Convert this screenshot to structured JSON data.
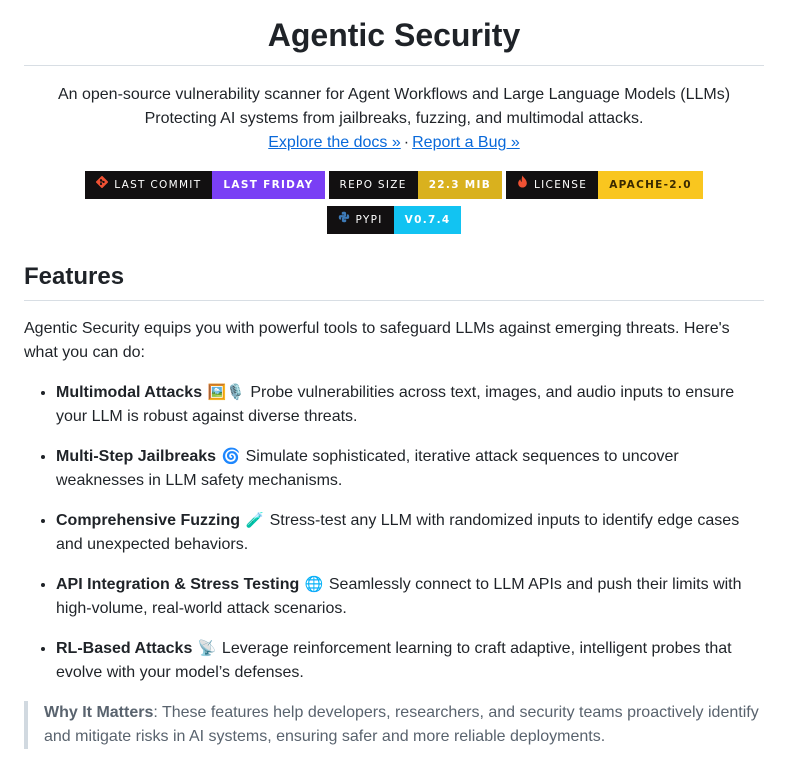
{
  "title": "Agentic Security",
  "description": {
    "line1": "An open-source vulnerability scanner for Agent Workflows and Large Language Models (LLMs)",
    "line2": "Protecting AI systems from jailbreaks, fuzzing, and multimodal attacks.",
    "docs_link": "Explore the docs »",
    "separator": "·",
    "bug_link": "Report a Bug »"
  },
  "badges": [
    {
      "label": "LAST COMMIT",
      "value": "LAST FRIDAY",
      "icon": "git-icon",
      "value_color": "#7a3ff5"
    },
    {
      "label": "REPO SIZE",
      "value": "22.3 MIB",
      "icon": "",
      "value_color": "#d9b11e"
    },
    {
      "label": "LICENSE",
      "value": "APACHE-2.0",
      "icon": "fire-icon",
      "value_color": "#f9c61f"
    },
    {
      "label": "PYPI",
      "value": "V0.7.4",
      "icon": "python-icon",
      "value_color": "#12c3f2"
    }
  ],
  "features": {
    "heading": "Features",
    "intro": "Agentic Security equips you with powerful tools to safeguard LLMs against emerging threats. Here's what you can do:",
    "items": [
      {
        "title": "Multimodal Attacks",
        "emoji": "🖼️🎙️",
        "text": " Probe vulnerabilities across text, images, and audio inputs to ensure your LLM is robust against diverse threats."
      },
      {
        "title": "Multi-Step Jailbreaks",
        "emoji": "🌀",
        "text": " Simulate sophisticated, iterative attack sequences to uncover weaknesses in LLM safety mechanisms."
      },
      {
        "title": "Comprehensive Fuzzing",
        "emoji": "🧪",
        "text": " Stress-test any LLM with randomized inputs to identify edge cases and unexpected behaviors."
      },
      {
        "title": "API Integration & Stress Testing",
        "emoji": "🌐",
        "text": " Seamlessly connect to LLM APIs and push their limits with high-volume, real-world attack scenarios."
      },
      {
        "title": "RL-Based Attacks",
        "emoji": "📡",
        "text": " Leverage reinforcement learning to craft adaptive, intelligent probes that evolve with your model’s defenses."
      }
    ]
  },
  "why": {
    "title": "Why It Matters",
    "text": ": These features help developers, researchers, and security teams proactively identify and mitigate risks in AI systems, ensuring safer and more reliable deployments."
  }
}
